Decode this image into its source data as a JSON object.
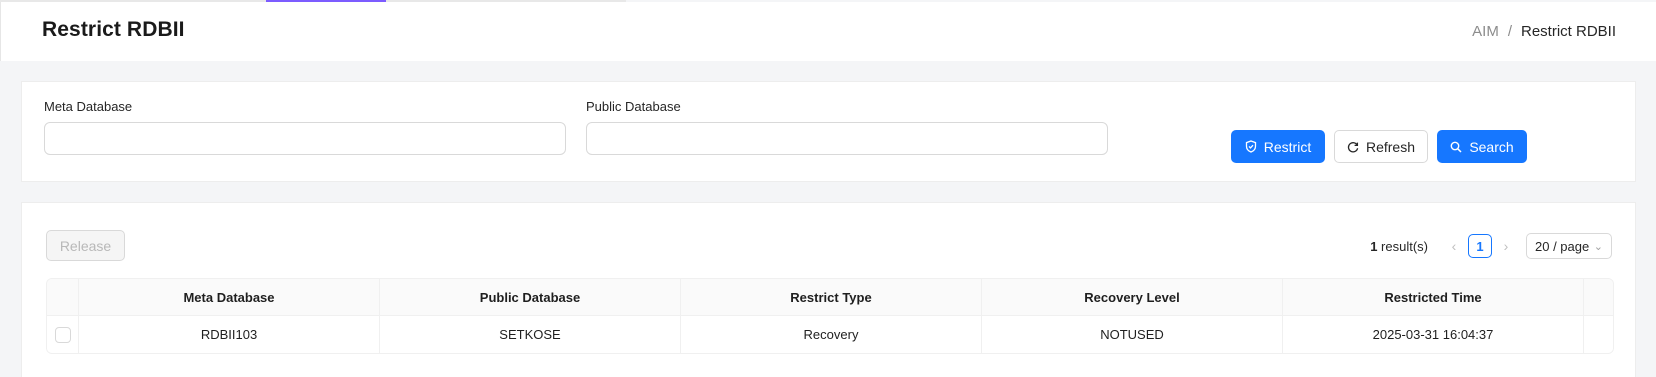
{
  "header": {
    "title": "Restrict RDBII",
    "breadcrumb": [
      "AIM",
      "/",
      "Restrict RDBII"
    ]
  },
  "filters": {
    "meta_label": "Meta Database",
    "meta_value": "",
    "public_label": "Public Database",
    "public_value": ""
  },
  "actions": {
    "restrict": "Restrict",
    "refresh": "Refresh",
    "search": "Search"
  },
  "table_toolbar": {
    "release": "Release",
    "total_count": "1",
    "total_suffix": " result(s)",
    "current_page": "1",
    "page_size": "20 / page"
  },
  "table": {
    "columns": [
      "Meta Database",
      "Public Database",
      "Restrict Type",
      "Recovery Level",
      "Restricted Time"
    ],
    "rows": [
      [
        "RDBII103",
        "SETKOSE",
        "Recovery",
        "NOTUSED",
        "2025-03-31 16:04:37"
      ]
    ]
  },
  "colors": {
    "primary": "#1677ff",
    "tab_accent": "#7c5cff"
  }
}
